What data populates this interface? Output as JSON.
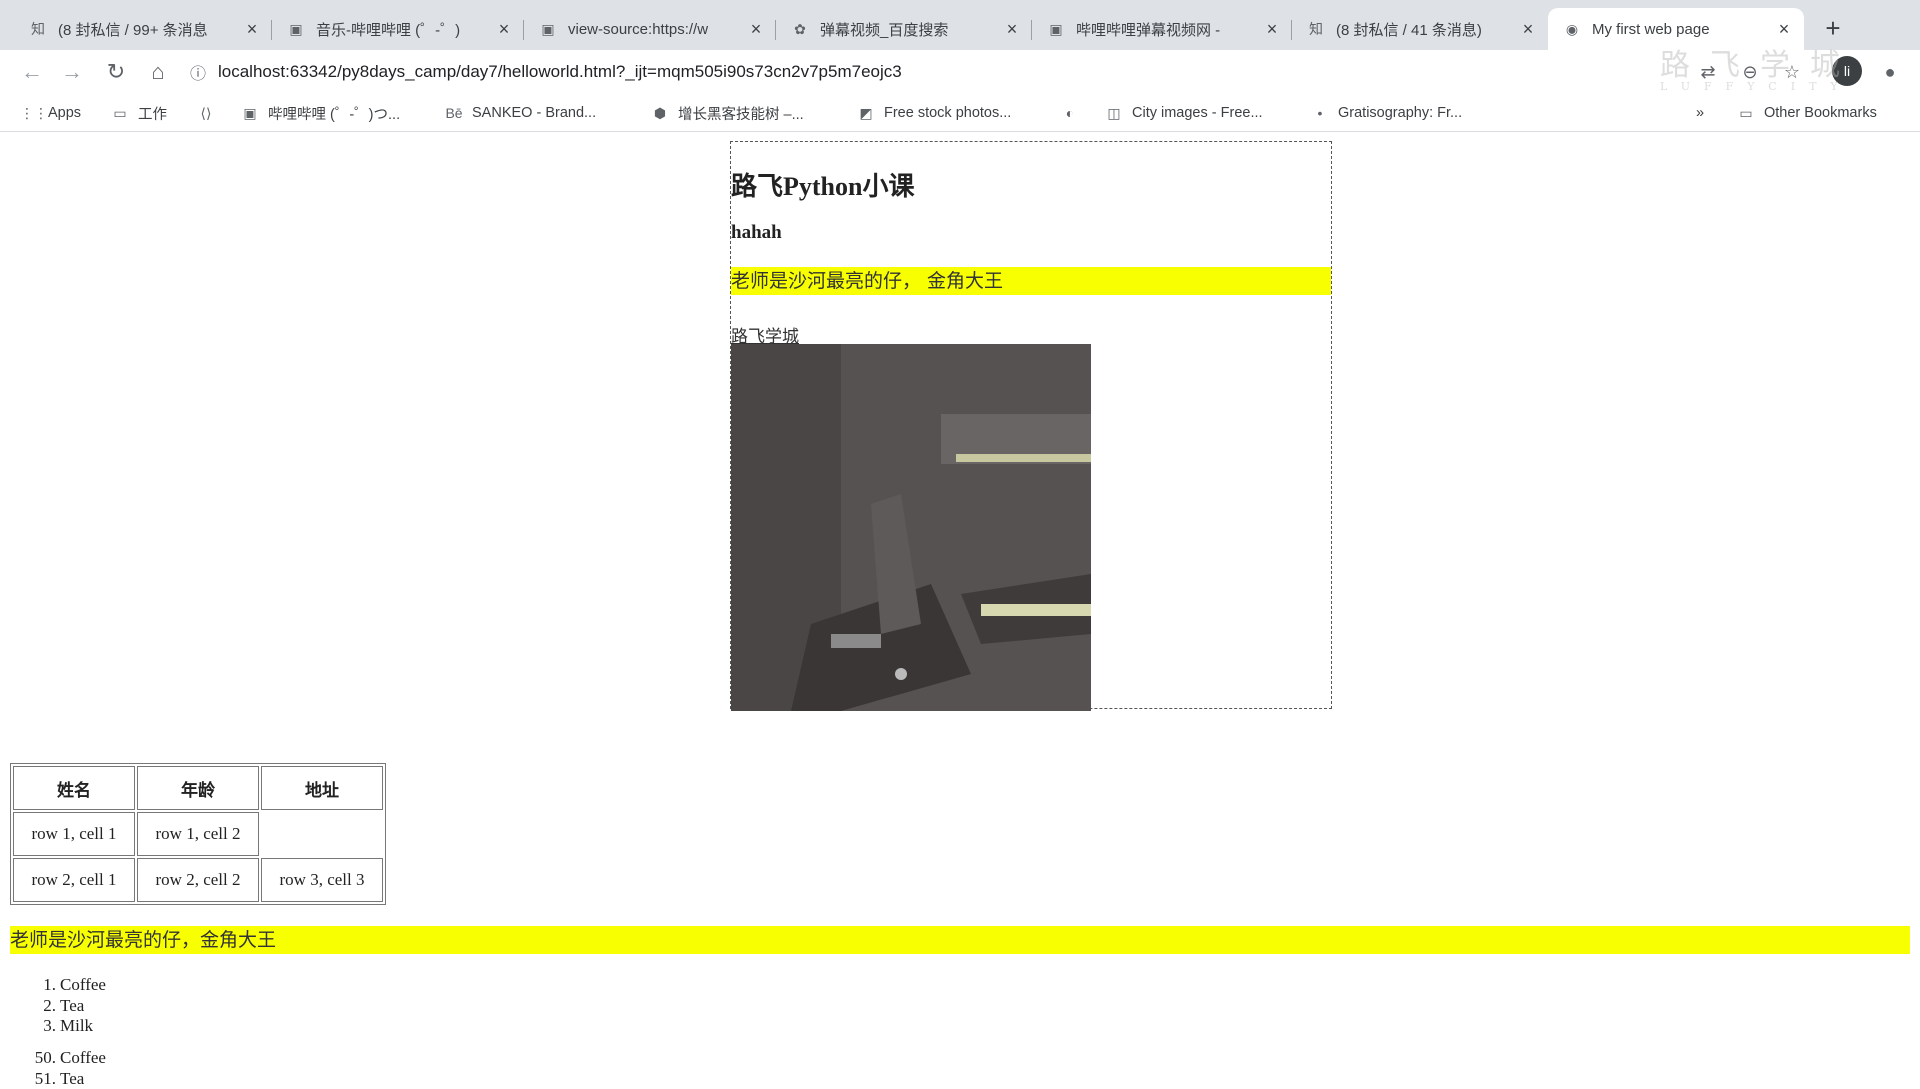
{
  "tabs": [
    {
      "icon": "zhihu-icon",
      "icon_glyph": "知",
      "title": "(8 封私信 / 99+ 条消息",
      "active": false
    },
    {
      "icon": "bilibili-icon",
      "icon_glyph": "▣",
      "title": "音乐-哔哩哔哩 (゜-゜)",
      "active": false
    },
    {
      "icon": "bilibili-icon",
      "icon_glyph": "▣",
      "title": "view-source:https://w",
      "active": false
    },
    {
      "icon": "baidu-paw-icon",
      "icon_glyph": "✿",
      "title": "弹幕视频_百度搜索",
      "active": false
    },
    {
      "icon": "bilibili-icon",
      "icon_glyph": "▣",
      "title": "哔哩哔哩弹幕视频网 -",
      "active": false
    },
    {
      "icon": "zhihu-icon",
      "icon_glyph": "知",
      "title": "(8 封私信 / 41 条消息)",
      "active": false
    },
    {
      "icon": "page-icon",
      "icon_glyph": "◉",
      "title": "My first web page",
      "active": true
    }
  ],
  "tab_close_glyph": "×",
  "new_tab_glyph": "+",
  "toolbar": {
    "back_glyph": "←",
    "forward_glyph": "→",
    "reload_glyph": "↻",
    "home_glyph": "⌂",
    "info_glyph": "ⓘ",
    "url": "localhost:63342/py8days_camp/day7/helloworld.html?_ijt=mqm505i90s73cn2v7p5m7eojc3",
    "translate_glyph": "⇄",
    "zoom_glyph": "⊖",
    "star_glyph": "☆",
    "profile_initial": "li",
    "extension_glyph": "●"
  },
  "watermark": {
    "cn": "路飞学城",
    "en": "LUFFYCITY"
  },
  "bookmarks": [
    {
      "icon": "apps-grid-icon",
      "glyph": "⋮⋮",
      "label": "Apps"
    },
    {
      "icon": "folder-icon",
      "glyph": "▭",
      "label": "工作"
    },
    {
      "icon": "code-icon",
      "glyph": "⟨⟩",
      "label": ""
    },
    {
      "icon": "bilibili-icon",
      "glyph": "▣",
      "label": "哔哩哔哩 (゜-゜)つ..."
    },
    {
      "icon": "behance-icon",
      "glyph": "Bē",
      "label": "SANKEO - Brand..."
    },
    {
      "icon": "gear-shield-icon",
      "glyph": "⬢",
      "label": "增长黑客技能树 –..."
    },
    {
      "icon": "photo-icon",
      "glyph": "◩",
      "label": "Free stock photos..."
    },
    {
      "icon": "globe-icon",
      "glyph": "◐",
      "label": ""
    },
    {
      "icon": "camera-icon",
      "glyph": "◫",
      "label": "City images - Free..."
    },
    {
      "icon": "dot-icon",
      "glyph": "•",
      "label": "Gratisography: Fr..."
    }
  ],
  "bookmarks_overflow": "»",
  "other_bookmarks": {
    "icon": "folder-icon",
    "glyph": "▭",
    "label": "Other Bookmarks"
  },
  "content": {
    "heading": "路飞Python小课",
    "subheading": "hahah",
    "highlight_text": "老师是沙河最亮的仔， 金角大王",
    "link_text": "路飞学城",
    "table": {
      "headers": [
        "姓名",
        "年龄",
        "地址"
      ],
      "rows": [
        [
          "row 1, cell 1",
          "row 1, cell 2",
          ""
        ],
        [
          "row 2, cell 1",
          "row 2, cell 2",
          "row 3, cell 3"
        ]
      ]
    },
    "highlight_text_2": "老师是沙河最亮的仔，金角大王",
    "list1": [
      {
        "num": "1.",
        "text": "Coffee"
      },
      {
        "num": "2.",
        "text": "Tea"
      },
      {
        "num": "3.",
        "text": "Milk"
      }
    ],
    "list2": [
      {
        "num": "50.",
        "text": "Coffee"
      },
      {
        "num": "51.",
        "text": "Tea"
      }
    ]
  }
}
